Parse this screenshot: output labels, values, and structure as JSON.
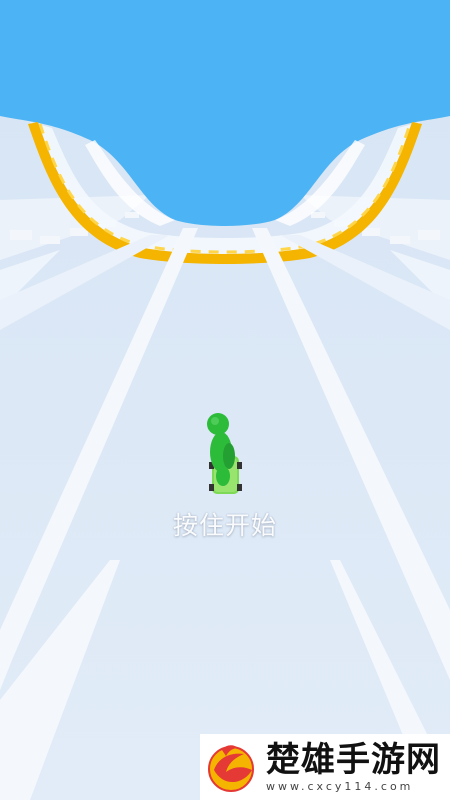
{
  "game": {
    "start_hint": "按住开始"
  },
  "watermark": {
    "title": "楚雄手游网",
    "url": "www.cxcy114.com"
  },
  "colors": {
    "sky": "#4cb4f4",
    "track": "#dce8f6",
    "lane_lines": "#f4f8fd",
    "rail_orange": "#f4b400",
    "character": "#2dbb3a",
    "skateboard": "#7ed957"
  }
}
